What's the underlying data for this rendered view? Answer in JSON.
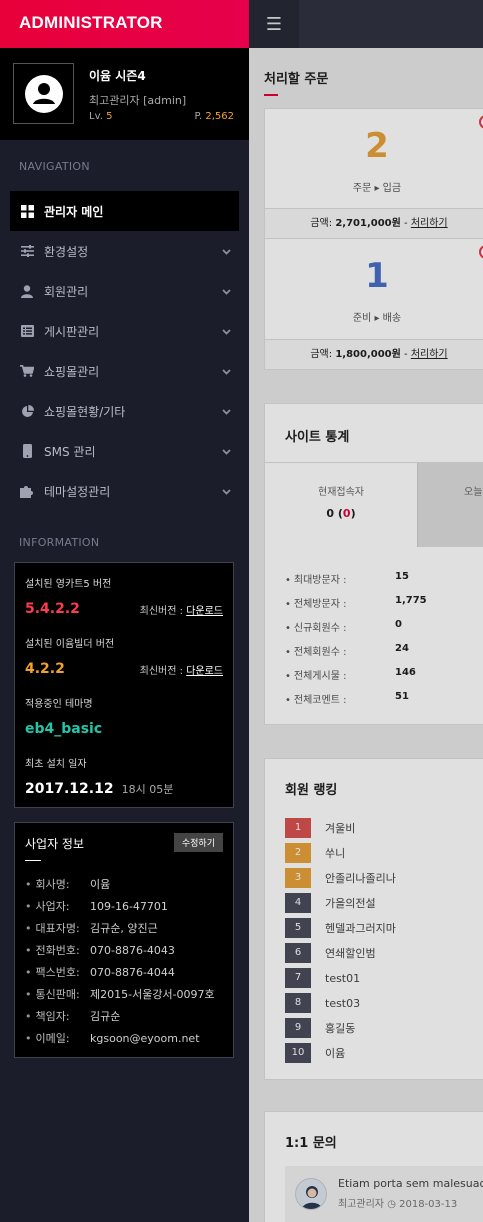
{
  "brand": {
    "title": "ADMINISTRATOR"
  },
  "profile": {
    "name": "이윰 시즌4",
    "role": "최고관리자 [admin]",
    "level_label": "Lv.",
    "level": "5",
    "point_label": "P.",
    "points": "2,562"
  },
  "navigation": {
    "heading": "NAVIGATION",
    "items": [
      {
        "label": "관리자 메인",
        "icon": "dashboard-icon",
        "active": true
      },
      {
        "label": "환경설정",
        "icon": "sliders-icon"
      },
      {
        "label": "회원관리",
        "icon": "user-icon"
      },
      {
        "label": "게시판관리",
        "icon": "list-icon"
      },
      {
        "label": "쇼핑몰관리",
        "icon": "cart-icon"
      },
      {
        "label": "쇼핑몰현황/기타",
        "icon": "pie-chart-icon"
      },
      {
        "label": "SMS 관리",
        "icon": "mobile-icon"
      },
      {
        "label": "테마설정관리",
        "icon": "puzzle-icon"
      }
    ]
  },
  "information": {
    "heading": "INFORMATION",
    "youngcart_label": "설치된 영카트5 버전",
    "youngcart_version": "5.4.2.2",
    "youngcart_latest": "최신버전 :",
    "youngcart_download": "다운로드",
    "builder_label": "설치된 이윰빌더 버전",
    "builder_version": "4.2.2",
    "builder_latest": "최신버전 :",
    "builder_download": "다운로드",
    "theme_label": "적용중인 테마명",
    "theme_name": "eb4_basic",
    "install_label": "최초 설치 일자",
    "install_date": "2017.12.12",
    "install_time": "18시 05분",
    "colors": {
      "youngcart": "#ff3b4f",
      "builder": "#f2a22c",
      "theme": "#22c7a9"
    }
  },
  "business": {
    "title": "사업자 정보",
    "edit_label": "수정하기",
    "rows": [
      {
        "key": "회사명:",
        "value": "이윰"
      },
      {
        "key": "사업자:",
        "value": "109-16-47701"
      },
      {
        "key": "대표자명:",
        "value": "김규순, 양진근"
      },
      {
        "key": "전화번호:",
        "value": "070-8876-4043"
      },
      {
        "key": "팩스번호:",
        "value": "070-8876-4044"
      },
      {
        "key": "통신판매:",
        "value": "제2015-서울강서-0097호"
      },
      {
        "key": "책임자:",
        "value": "김규순"
      },
      {
        "key": "이메일:",
        "value": "kgsoon@eyoom.net"
      }
    ]
  },
  "topbar": {
    "menu_icon": "hamburger-icon",
    "menu_glyph": "☰"
  },
  "orders": {
    "title": "처리할 주문",
    "cards": [
      {
        "count": "2",
        "label": "주문 ▸ 입금",
        "amount_label": "금액:",
        "amount": "2,701,000원",
        "sep": "-",
        "action": "처리하기",
        "color": "#e8a23a"
      },
      {
        "count": "1",
        "label": "준비 ▸ 배송",
        "amount_label": "금액:",
        "amount": "1,800,000원",
        "sep": "-",
        "action": "처리하기",
        "color": "#4a6fc7"
      }
    ]
  },
  "site_stats": {
    "title": "사이트 통계",
    "tab_current_label": "현재접속자",
    "tab_current_value": "0",
    "tab_current_red": "0",
    "tab_today_label": "오늘",
    "rows": [
      {
        "key": "최대방문자 :",
        "value": "15"
      },
      {
        "key": "전체방문자 :",
        "value": "1,775"
      },
      {
        "key": "신규회원수 :",
        "value": "0"
      },
      {
        "key": "전체회원수 :",
        "value": "24"
      },
      {
        "key": "전체게시물 :",
        "value": "146"
      },
      {
        "key": "전체코멘트 :",
        "value": "51"
      }
    ]
  },
  "member_ranking": {
    "title": "회원 랭킹",
    "rows": [
      {
        "rank": "1",
        "name": "겨울비",
        "color": "#d9534f"
      },
      {
        "rank": "2",
        "name": "쑤니",
        "color": "#e8a23a"
      },
      {
        "rank": "3",
        "name": "안졸리나졸리나",
        "color": "#e8a23a"
      },
      {
        "rank": "4",
        "name": "가을의전설",
        "color": "#4a4d5c"
      },
      {
        "rank": "5",
        "name": "헨델과그러지마",
        "color": "#4a4d5c"
      },
      {
        "rank": "6",
        "name": "연쇄할인범",
        "color": "#4a4d5c"
      },
      {
        "rank": "7",
        "name": "test01",
        "color": "#4a4d5c"
      },
      {
        "rank": "8",
        "name": "test03",
        "color": "#4a4d5c"
      },
      {
        "rank": "9",
        "name": "홍길동",
        "color": "#4a4d5c"
      },
      {
        "rank": "10",
        "name": "이윰",
        "color": "#4a4d5c"
      }
    ]
  },
  "qna": {
    "title": "1:1 문의",
    "item_text": "Etiam porta sem malesuada",
    "item_author": "최고관리자",
    "item_date": "2018-03-13"
  }
}
